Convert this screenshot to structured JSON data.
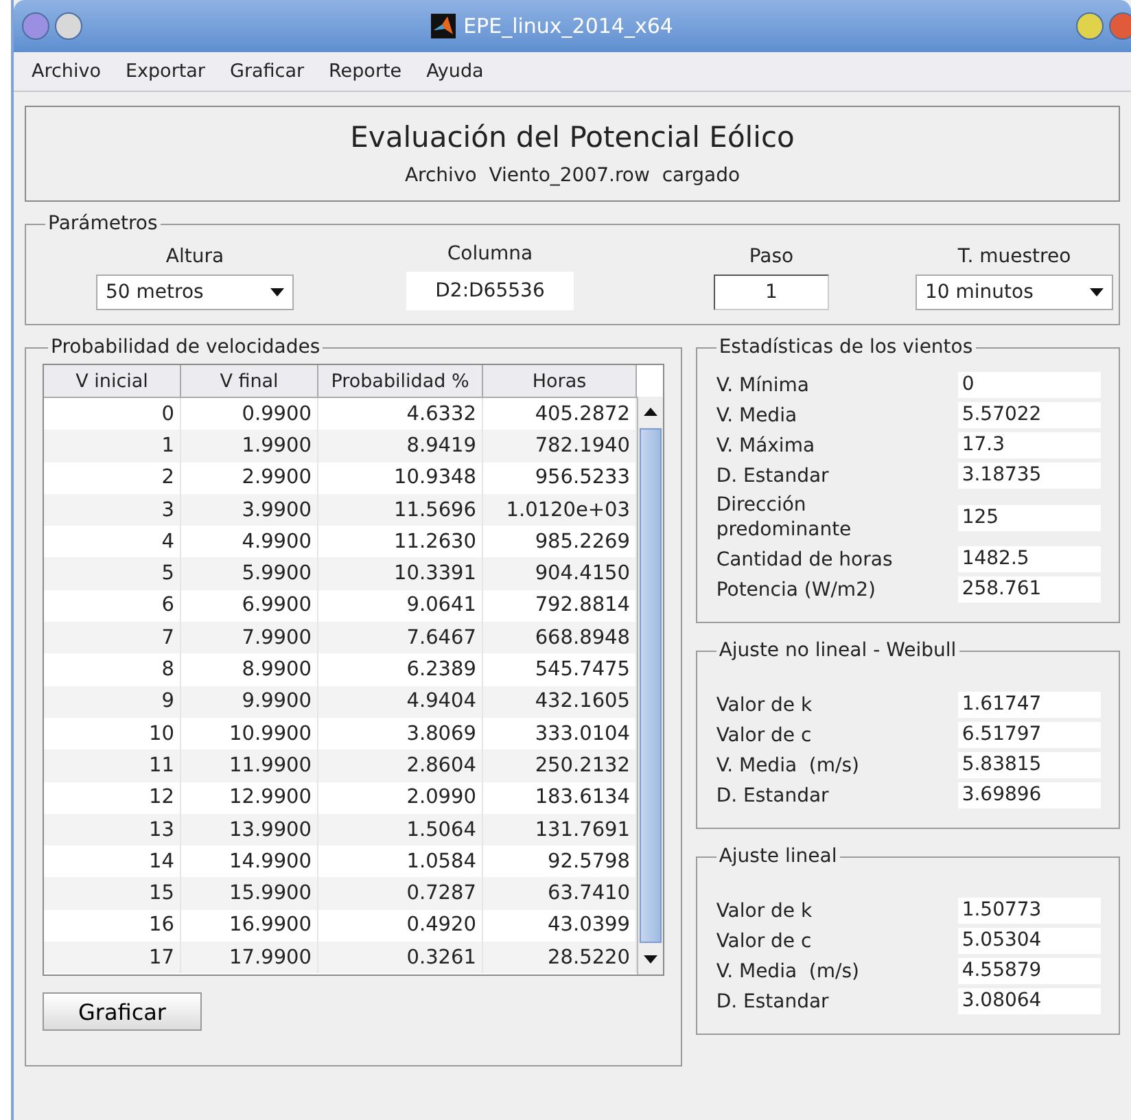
{
  "window": {
    "title": "EPE_linux_2014_x64"
  },
  "menu": [
    "Archivo",
    "Exportar",
    "Graficar",
    "Reporte",
    "Ayuda"
  ],
  "header": {
    "title": "Evaluación del Potencial Eólico",
    "subtitle": "Archivo  Viento_2007.row  cargado"
  },
  "parameters": {
    "title": "Parámetros",
    "fields": [
      {
        "label": "Altura",
        "value": "50 metros",
        "kind": "dropdown"
      },
      {
        "label": "Columna",
        "value": "D2:D65536",
        "kind": "text"
      },
      {
        "label": "Paso",
        "value": "1",
        "kind": "input"
      },
      {
        "label": "T. muestreo",
        "value": "10 minutos",
        "kind": "dropdown"
      }
    ]
  },
  "probability": {
    "title": "Probabilidad de velocidades",
    "columns": [
      "V inicial",
      "V final",
      "Probabilidad %",
      "Horas"
    ],
    "rows": [
      [
        "0",
        "0.9900",
        "4.6332",
        "405.2872"
      ],
      [
        "1",
        "1.9900",
        "8.9419",
        "782.1940"
      ],
      [
        "2",
        "2.9900",
        "10.9348",
        "956.5233"
      ],
      [
        "3",
        "3.9900",
        "11.5696",
        "1.0120e+03"
      ],
      [
        "4",
        "4.9900",
        "11.2630",
        "985.2269"
      ],
      [
        "5",
        "5.9900",
        "10.3391",
        "904.4150"
      ],
      [
        "6",
        "6.9900",
        "9.0641",
        "792.8814"
      ],
      [
        "7",
        "7.9900",
        "7.6467",
        "668.8948"
      ],
      [
        "8",
        "8.9900",
        "6.2389",
        "545.7475"
      ],
      [
        "9",
        "9.9900",
        "4.9404",
        "432.1605"
      ],
      [
        "10",
        "10.9900",
        "3.8069",
        "333.0104"
      ],
      [
        "11",
        "11.9900",
        "2.8604",
        "250.2132"
      ],
      [
        "12",
        "12.9900",
        "2.0990",
        "183.6134"
      ],
      [
        "13",
        "13.9900",
        "1.5064",
        "131.7691"
      ],
      [
        "14",
        "14.9900",
        "1.0584",
        "92.5798"
      ],
      [
        "15",
        "15.9900",
        "0.7287",
        "63.7410"
      ],
      [
        "16",
        "16.9900",
        "0.4920",
        "43.0399"
      ],
      [
        "17",
        "17.9900",
        "0.3261",
        "28.5220"
      ]
    ],
    "button": "Graficar"
  },
  "statistics": {
    "title": "Estadísticas de los vientos",
    "rows": [
      {
        "label": "V. Mínima",
        "value": "0"
      },
      {
        "label": "V. Media",
        "value": "5.57022"
      },
      {
        "label": "V. Máxima",
        "value": "17.3"
      },
      {
        "label": "D. Estandar",
        "value": "3.18735"
      },
      {
        "label": "Dirección predominante",
        "value": "125"
      },
      {
        "label": "Cantidad de horas",
        "value": "1482.5"
      },
      {
        "label": "Potencia (W/m2)",
        "value": "258.761"
      }
    ]
  },
  "weibull": {
    "title": "Ajuste no lineal - Weibull",
    "rows": [
      {
        "label": "Valor de k",
        "value": "1.61747"
      },
      {
        "label": "Valor de c",
        "value": "6.51797"
      },
      {
        "label": "V. Media  (m/s)",
        "value": "5.83815"
      },
      {
        "label": "D. Estandar",
        "value": "3.69896"
      }
    ]
  },
  "linear": {
    "title": "Ajuste lineal",
    "rows": [
      {
        "label": "Valor de k",
        "value": "1.50773"
      },
      {
        "label": "Valor de c",
        "value": "5.05304"
      },
      {
        "label": "V. Media  (m/s)",
        "value": "4.55879"
      },
      {
        "label": "D. Estandar",
        "value": "3.08064"
      }
    ]
  }
}
